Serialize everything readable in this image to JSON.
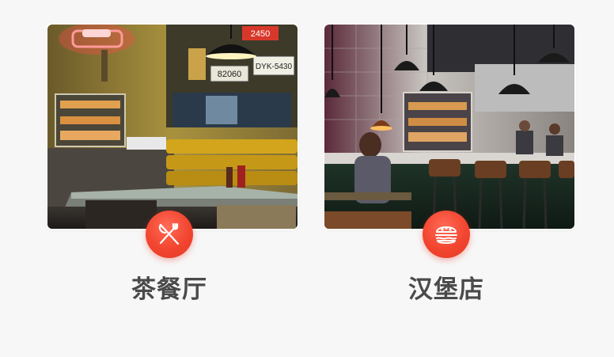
{
  "categories": [
    {
      "label": "茶餐厅",
      "photo": "cha-chaan-teng-restaurant-photo",
      "icon": "fork-knife-icon",
      "sign_texts": [
        "2450",
        "82060",
        "DYK-5430"
      ]
    },
    {
      "label": "汉堡店",
      "photo": "burger-shop-interior-photo",
      "icon": "hamburger-icon"
    }
  ],
  "colors": {
    "background": "#f7f7f7",
    "badge": "#f2452f",
    "label_text": "#4a4a4a"
  }
}
